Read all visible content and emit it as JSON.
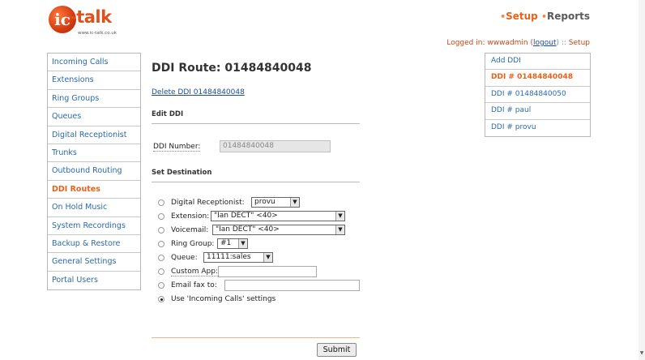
{
  "logo": {
    "mark": "ic",
    "word": "-talk",
    "url": "www.ic-talk.co.uk"
  },
  "topnav": {
    "active": "Setup",
    "other": "Reports"
  },
  "login": {
    "prefix": "Logged in: wwwadmin (",
    "logout": "logout",
    "suffix": ") ::",
    "setup": "Setup"
  },
  "leftnav": {
    "items": [
      {
        "label": "Incoming Calls"
      },
      {
        "label": "Extensions"
      },
      {
        "label": "Ring Groups"
      },
      {
        "label": "Queues"
      },
      {
        "label": "Digital Receptionist"
      },
      {
        "label": "Trunks"
      },
      {
        "label": "Outbound Routing"
      },
      {
        "label": "DDI Routes",
        "active": true
      },
      {
        "label": "On Hold Music"
      },
      {
        "label": "System Recordings"
      },
      {
        "label": "Backup & Restore"
      },
      {
        "label": "General Settings"
      },
      {
        "label": "Portal Users"
      }
    ]
  },
  "rightnav": {
    "items": [
      {
        "label": "Add DDI"
      },
      {
        "label": "DDI # 01484840048",
        "active": true
      },
      {
        "label": "DDI # 01484840050"
      },
      {
        "label": "DDI # paul"
      },
      {
        "label": "DDI # provu"
      }
    ]
  },
  "page": {
    "title": "DDI Route: 01484840048",
    "delete_link": "Delete DDI 01484840048",
    "edit_section": "Edit DDI",
    "ddi_label": "DDI Number:",
    "ddi_value": "01484840048",
    "dest_section": "Set Destination"
  },
  "destinations": {
    "digital_receptionist": {
      "label": "Digital Receptionist:",
      "value": "provu"
    },
    "extension": {
      "label": "Extension:",
      "value": "\"Ian DECT\" <40>"
    },
    "voicemail": {
      "label": "Voicemail:",
      "value": "\"Ian DECT\" <40>"
    },
    "ring_group": {
      "label": "Ring Group:",
      "value": "#1"
    },
    "queue": {
      "label": "Queue:",
      "value": "11111:sales"
    },
    "custom_app": {
      "label": "Custom App:",
      "value": ""
    },
    "email_fax": {
      "label": "Email fax to:",
      "value": ""
    },
    "incoming": {
      "label": "Use 'Incoming Calls' settings"
    }
  },
  "submit_label": "Submit"
}
